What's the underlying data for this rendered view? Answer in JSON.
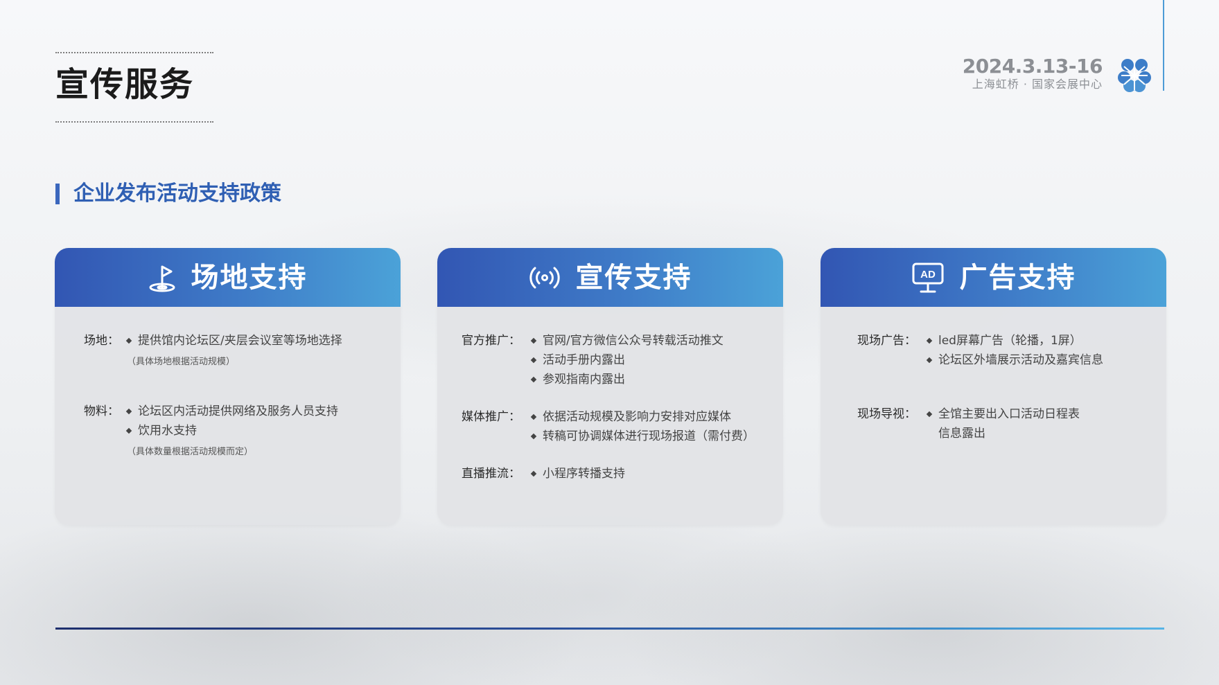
{
  "header": {
    "title": "宣传服务",
    "event_date": "2024.3.13-16",
    "event_venue": "上海虹桥 · 国家会展中心",
    "logo_icon": "clover-logo-icon"
  },
  "section": {
    "title": "企业发布活动支持政策"
  },
  "colors": {
    "accent_blue": "#3b67bd",
    "header_gradient_start": "#3256b3",
    "header_gradient_end": "#4ba2d8",
    "card_bg": "#e2e3e6"
  },
  "cards": [
    {
      "title": "场地支持",
      "icon": "venue-pin-icon",
      "rows": [
        {
          "label": "场地：",
          "items": [
            "提供馆内论坛区/夹层会议室等场地选择"
          ],
          "note": "（具体场地根据活动规模）"
        },
        {
          "label": "物料：",
          "items": [
            "论坛区内活动提供网络及服务人员支持",
            "饮用水支持"
          ],
          "note": "（具体数量根据活动规模而定）"
        }
      ]
    },
    {
      "title": "宣传支持",
      "icon": "broadcast-icon",
      "rows": [
        {
          "label": "官方推广：",
          "items": [
            "官网/官方微信公众号转载活动推文",
            "活动手册内露出",
            "参观指南内露出"
          ]
        },
        {
          "label": "媒体推广：",
          "items": [
            "依据活动规模及影响力安排对应媒体",
            "转稿可协调媒体进行现场报道（需付费）"
          ]
        },
        {
          "label": "直播推流：",
          "items": [
            "小程序转播支持"
          ]
        }
      ]
    },
    {
      "title": "广告支持",
      "icon": "ad-screen-icon",
      "ad_badge": "AD",
      "rows": [
        {
          "label": "现场广告：",
          "items": [
            "led屏幕广告（轮播，1屏）",
            "论坛区外墙展示活动及嘉宾信息"
          ]
        },
        {
          "label": "现场导视：",
          "items": [
            "全馆主要出入口活动日程表",
            "信息露出"
          ]
        }
      ]
    }
  ]
}
